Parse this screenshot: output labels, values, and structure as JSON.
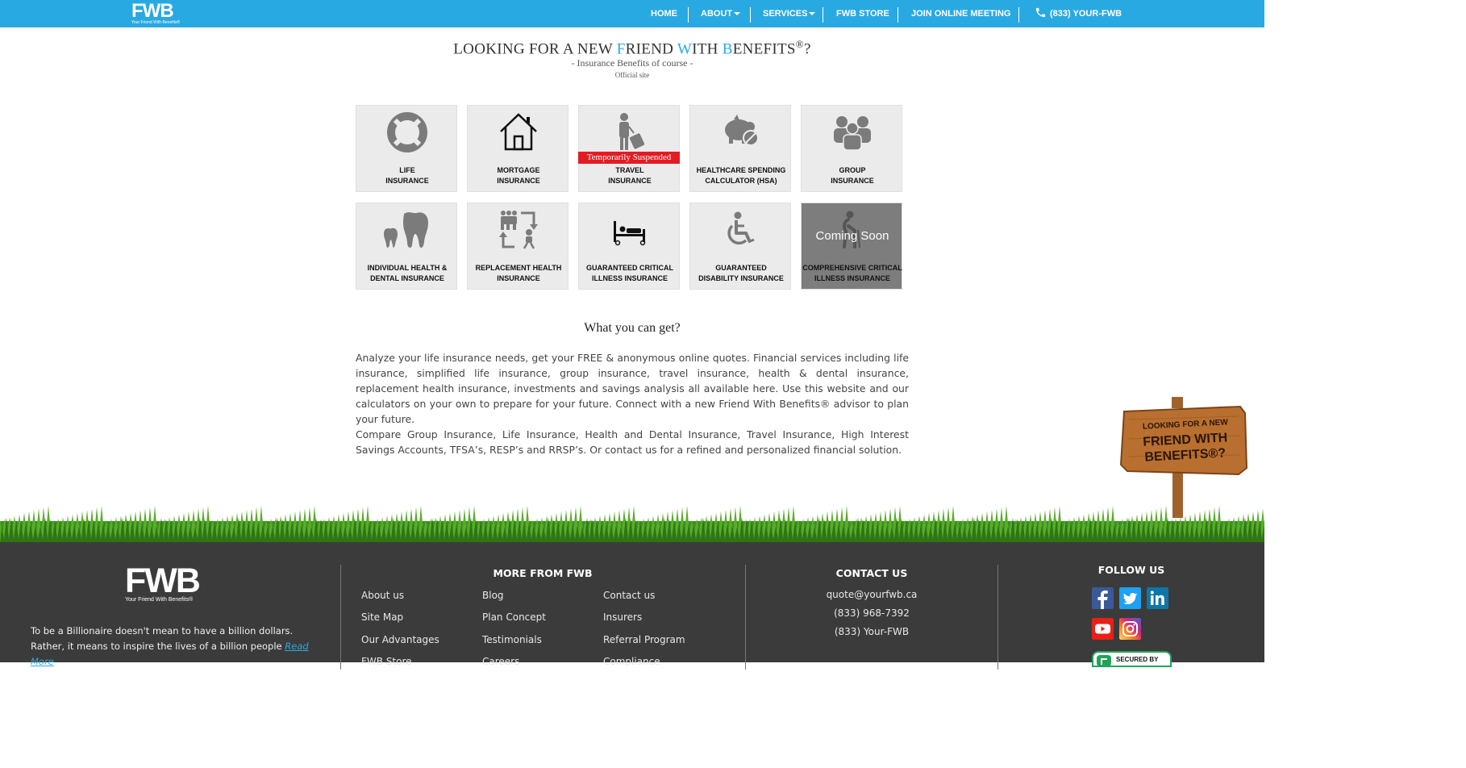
{
  "nav": {
    "logo_mark": "FWB",
    "logo_tagline": "Your Friend With Benefits®",
    "home": "HOME",
    "about": "ABOUT",
    "services": "SERVICES",
    "store": "FWB STORE",
    "meeting": "JOIN ONLINE MEETING",
    "phone": "(833) YOUR-FWB"
  },
  "hero": {
    "title_parts": [
      "LOOKING FOR A NEW ",
      "F",
      "RIEND ",
      "W",
      "ITH ",
      "B",
      "ENEFITS",
      "®",
      "?"
    ],
    "subtitle": "- Insurance Benefits of course -",
    "small": "Official site"
  },
  "tiles": [
    {
      "line1": "LIFE",
      "line2": "INSURANCE",
      "icon": "lifebuoy-icon"
    },
    {
      "line1": "MORTGAGE",
      "line2": "INSURANCE",
      "icon": "house-icon"
    },
    {
      "line1": "TRAVEL",
      "line2": "INSURANCE",
      "icon": "traveler-icon",
      "badge": "Temporarily Suspended"
    },
    {
      "line1": "HEALTHCARE SPENDING",
      "line2": "CALCULATOR (HSA)",
      "icon": "piggy-bank-icon"
    },
    {
      "line1": "GROUP",
      "line2": "INSURANCE",
      "icon": "group-icon"
    },
    {
      "line1": "INDIVIDUAL HEALTH &",
      "line2": "DENTAL INSURANCE",
      "icon": "tooth-icon"
    },
    {
      "line1": "REPLACEMENT HEALTH",
      "line2": "INSURANCE",
      "icon": "replacement-icon"
    },
    {
      "line1": "GUARANTEED CRITICAL",
      "line2": "ILLNESS INSURANCE",
      "icon": "hospital-bed-icon"
    },
    {
      "line1": "GUARANTEED",
      "line2": "DISABILITY INSURANCE",
      "icon": "wheelchair-icon"
    },
    {
      "line1": "COMPREHENSIVE CRITICAL",
      "line2": "ILLNESS INSURANCE",
      "icon": "elderly-icon",
      "overlay": "Coming Soon"
    }
  ],
  "content": {
    "heading": "What you can get?",
    "para1": "Analyze your life insurance needs, get your FREE & anonymous online quotes. Financial services including life insurance, simplified life insurance, group insurance, travel insurance, health & dental insurance, replacement health insurance, investments and savings analysis all available here. Use this website and our calculators on your own to prepare for your future. Connect with a new Friend With Benefits® advisor to plan your future.",
    "para2": "Compare Group Insurance, Life Insurance, Health and Dental Insurance, Travel Insurance, High Interest Savings Accounts, TFSA’s, RESP’s and RRSP’s. Or contact us for a refined and personalized financial solution."
  },
  "sign": {
    "line1": "LOOKING FOR A NEW",
    "line2": "FRIEND WITH",
    "line3": "BENEFITS®?"
  },
  "footer": {
    "logo_mark": "FWB",
    "logo_tagline": "Your Friend With Benefits®",
    "tagline": "To be a Billionaire doesn't mean to have a billion dollars. Rather, it means to inspire the lives of a billion people",
    "read_more": "Read More",
    "more_heading": "MORE FROM FWB",
    "links_col1": [
      "About us",
      "Site Map",
      "Our Advantages",
      "FWB Store"
    ],
    "links_col2": [
      "Blog",
      "Plan Concept",
      "Testimonials",
      "Careers"
    ],
    "links_col3": [
      "Contact us",
      "Insurers",
      "Referral Program",
      "Compliance"
    ],
    "contact_heading": "CONTACT US",
    "email": "quote@yourfwb.ca",
    "phone1": "(833) 968-7392",
    "phone2": "(833) Your-FWB",
    "follow_heading": "FOLLOW US",
    "secured": "SECURED BY"
  },
  "colors": {
    "brand": "#29a9e1",
    "footer_bg": "#3b3b3b",
    "suspended": "#e31c23"
  }
}
